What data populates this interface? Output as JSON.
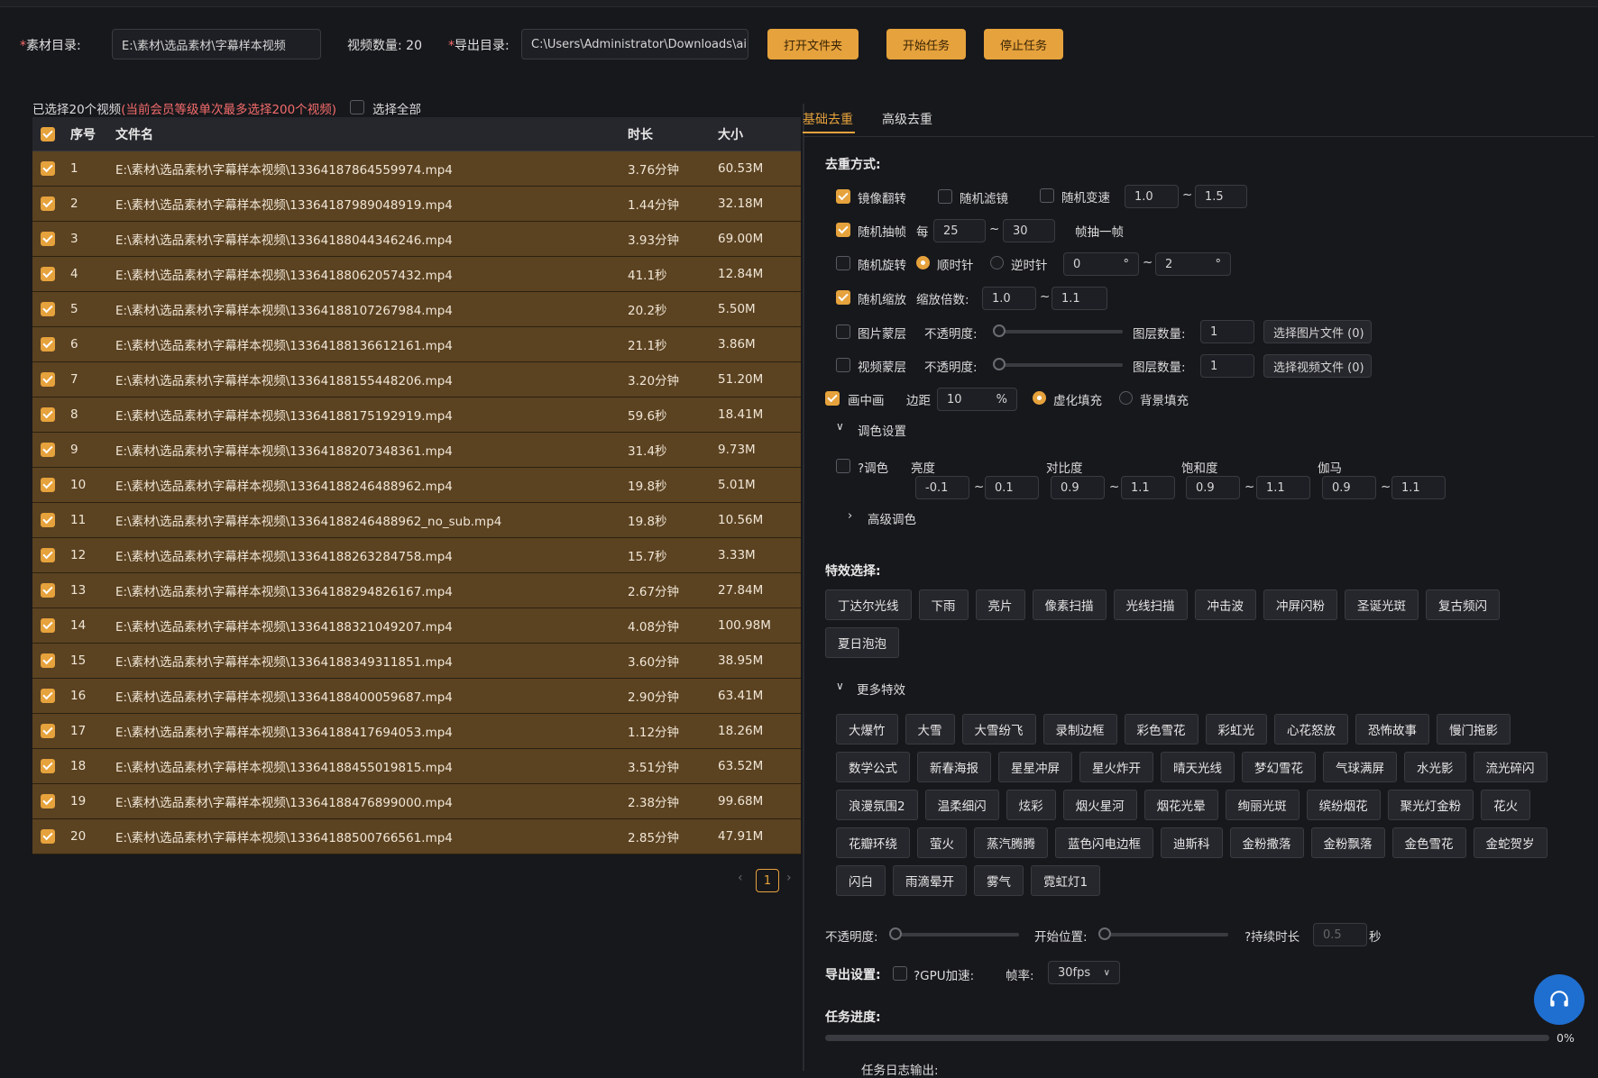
{
  "top": {
    "material_label": "素材目录:",
    "material_path": "E:\\素材\\选品素材\\字幕样本视频",
    "count_label": "视频数量: 20",
    "export_label": "导出目录:",
    "export_path": "C:\\Users\\Administrator\\Downloads\\ai",
    "btn_open": "打开文件夹",
    "btn_start": "开始任务",
    "btn_stop": "停止任务"
  },
  "selection": {
    "selected_text": "已选择20个视频",
    "limit_note": "(当前会员等级单次最多选择200个视频)",
    "select_all": "选择全部"
  },
  "table": {
    "headers": [
      "序号",
      "文件名",
      "时长",
      "大小"
    ],
    "rows": [
      {
        "idx": "1",
        "file": "E:\\素材\\选品素材\\字幕样本视频\\13364187864559974.mp4",
        "dur": "3.76分钟",
        "size": "60.53M"
      },
      {
        "idx": "2",
        "file": "E:\\素材\\选品素材\\字幕样本视频\\13364187989048919.mp4",
        "dur": "1.44分钟",
        "size": "32.18M"
      },
      {
        "idx": "3",
        "file": "E:\\素材\\选品素材\\字幕样本视频\\13364188044346246.mp4",
        "dur": "3.93分钟",
        "size": "69.00M"
      },
      {
        "idx": "4",
        "file": "E:\\素材\\选品素材\\字幕样本视频\\13364188062057432.mp4",
        "dur": "41.1秒",
        "size": "12.84M"
      },
      {
        "idx": "5",
        "file": "E:\\素材\\选品素材\\字幕样本视频\\13364188107267984.mp4",
        "dur": "20.2秒",
        "size": "5.50M"
      },
      {
        "idx": "6",
        "file": "E:\\素材\\选品素材\\字幕样本视频\\13364188136612161.mp4",
        "dur": "21.1秒",
        "size": "3.86M"
      },
      {
        "idx": "7",
        "file": "E:\\素材\\选品素材\\字幕样本视频\\13364188155448206.mp4",
        "dur": "3.20分钟",
        "size": "51.20M"
      },
      {
        "idx": "8",
        "file": "E:\\素材\\选品素材\\字幕样本视频\\13364188175192919.mp4",
        "dur": "59.6秒",
        "size": "18.41M"
      },
      {
        "idx": "9",
        "file": "E:\\素材\\选品素材\\字幕样本视频\\13364188207348361.mp4",
        "dur": "31.4秒",
        "size": "9.73M"
      },
      {
        "idx": "10",
        "file": "E:\\素材\\选品素材\\字幕样本视频\\13364188246488962.mp4",
        "dur": "19.8秒",
        "size": "5.01M"
      },
      {
        "idx": "11",
        "file": "E:\\素材\\选品素材\\字幕样本视频\\13364188246488962_no_sub.mp4",
        "dur": "19.8秒",
        "size": "10.56M"
      },
      {
        "idx": "12",
        "file": "E:\\素材\\选品素材\\字幕样本视频\\13364188263284758.mp4",
        "dur": "15.7秒",
        "size": "3.33M"
      },
      {
        "idx": "13",
        "file": "E:\\素材\\选品素材\\字幕样本视频\\13364188294826167.mp4",
        "dur": "2.67分钟",
        "size": "27.84M"
      },
      {
        "idx": "14",
        "file": "E:\\素材\\选品素材\\字幕样本视频\\13364188321049207.mp4",
        "dur": "4.08分钟",
        "size": "100.98M"
      },
      {
        "idx": "15",
        "file": "E:\\素材\\选品素材\\字幕样本视频\\13364188349311851.mp4",
        "dur": "3.60分钟",
        "size": "38.95M"
      },
      {
        "idx": "16",
        "file": "E:\\素材\\选品素材\\字幕样本视频\\13364188400059687.mp4",
        "dur": "2.90分钟",
        "size": "63.41M"
      },
      {
        "idx": "17",
        "file": "E:\\素材\\选品素材\\字幕样本视频\\13364188417694053.mp4",
        "dur": "1.12分钟",
        "size": "18.26M"
      },
      {
        "idx": "18",
        "file": "E:\\素材\\选品素材\\字幕样本视频\\13364188455019815.mp4",
        "dur": "3.51分钟",
        "size": "63.52M"
      },
      {
        "idx": "19",
        "file": "E:\\素材\\选品素材\\字幕样本视频\\13364188476899000.mp4",
        "dur": "2.38分钟",
        "size": "99.68M"
      },
      {
        "idx": "20",
        "file": "E:\\素材\\选品素材\\字幕样本视频\\13364188500766561.mp4",
        "dur": "2.85分钟",
        "size": "47.91M"
      }
    ],
    "page": "1"
  },
  "tabs": [
    "基础去重",
    "高级去重"
  ],
  "dedup": {
    "title": "去重方式:",
    "mirror": "镜像翻转",
    "random_filter": "随机滤镜",
    "random_speed": "随机变速",
    "speed_min": "1.0",
    "speed_max": "1.5",
    "tilde": "~",
    "random_frame": "随机抽帧",
    "every": "每",
    "frame_min": "25",
    "frame_max": "30",
    "frame_suffix": "帧抽一帧",
    "random_rotate": "随机旋转",
    "clockwise": "顺时针",
    "counter": "逆时针",
    "rot_min": "0",
    "rot_max": "2",
    "deg": "°",
    "random_scale": "随机缩放",
    "scale_label": "缩放倍数:",
    "scale_min": "1.0",
    "scale_max": "1.1",
    "img_layer": "图片蒙层",
    "opacity_label": "不透明度:",
    "layer_count_label": "图层数量:",
    "img_layer_count": "1",
    "img_select_btn": "选择图片文件 (0)",
    "video_layer": "视频蒙层",
    "video_layer_count": "1",
    "video_select_btn": "选择视频文件 (0)",
    "pip": "画中画",
    "margin_label": "边距",
    "margin_val": "10",
    "percent": "%",
    "blur_fill": "虚化填充",
    "bg_fill": "背景填充",
    "color_settings": "调色设置",
    "color_label": "?调色",
    "brightness": "亮度",
    "contrast": "对比度",
    "saturation": "饱和度",
    "gamma": "伽马",
    "b_min": "-0.1",
    "b_max": "0.1",
    "c_min": "0.9",
    "c_max": "1.1",
    "s_min": "0.9",
    "s_max": "1.1",
    "g_min": "0.9",
    "g_max": "1.1",
    "advanced_color": "高级调色"
  },
  "effects": {
    "title": "特效选择:",
    "basic": [
      "丁达尔光线",
      "下雨",
      "亮片",
      "像素扫描",
      "光线扫描",
      "冲击波",
      "冲屏闪粉",
      "圣诞光斑",
      "复古频闪",
      "夏日泡泡"
    ],
    "more_title": "更多特效",
    "more": [
      "大爆竹",
      "大雪",
      "大雪纷飞",
      "录制边框",
      "彩色雪花",
      "彩虹光",
      "心花怒放",
      "恐怖故事",
      "慢门拖影",
      "数学公式",
      "新春海报",
      "星星冲屏",
      "星火炸开",
      "晴天光线",
      "梦幻雪花",
      "气球满屏",
      "水光影",
      "流光碎闪",
      "浪漫氛围2",
      "温柔细闪",
      "炫彩",
      "烟火星河",
      "烟花光晕",
      "绚丽光斑",
      "缤纷烟花",
      "聚光灯金粉",
      "花火",
      "花瓣环绕",
      "萤火",
      "蒸汽腾腾",
      "蓝色闪电边框",
      "迪斯科",
      "金粉撒落",
      "金粉飘落",
      "金色雪花",
      "金蛇贺岁",
      "闪白",
      "雨滴晕开",
      "雾气",
      "霓虹灯1"
    ],
    "opacity_label": "不透明度:",
    "start_label": "开始位置:",
    "duration_label": "?持续时长",
    "duration_val": "0.5",
    "sec": "秒"
  },
  "export": {
    "title": "导出设置:",
    "gpu": "?GPU加速:",
    "fps_label": "帧率:",
    "fps_val": "30fps"
  },
  "progress": {
    "title": "任务进度:",
    "value": 0,
    "percent_text": "0%",
    "log_label": "任务日志输出:"
  },
  "colors": {
    "accent": "#e6a23c",
    "row_bg": "#5b4221",
    "support": "#1f6fd1"
  }
}
